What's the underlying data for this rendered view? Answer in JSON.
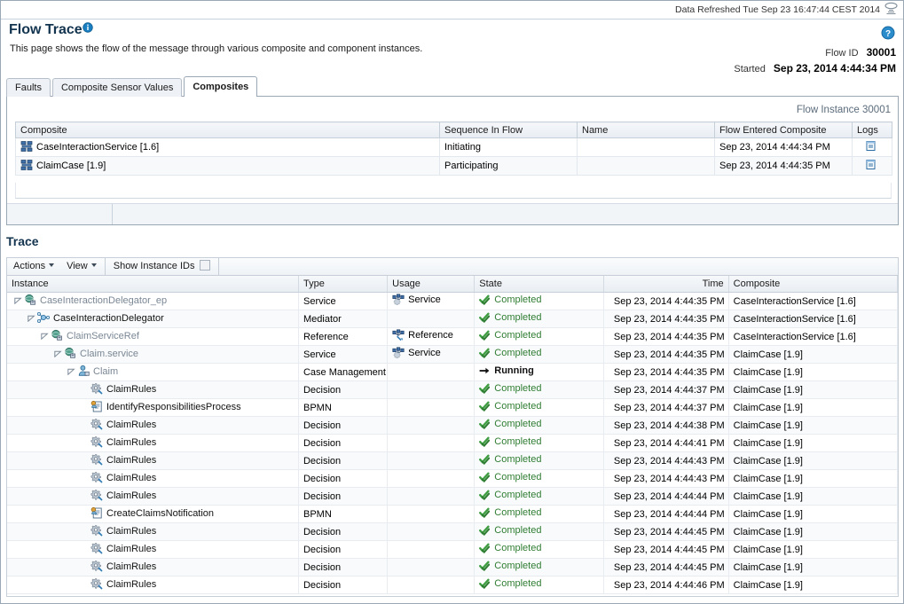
{
  "refresh": {
    "text": "Data Refreshed Tue Sep 23 16:47:44 CEST 2014",
    "icon": "refresh-monitor-icon"
  },
  "header": {
    "title": "Flow Trace",
    "title_info_icon": "info-icon",
    "subtitle": "This page shows the flow of the message through various composite and component instances.",
    "help_icon": "help-icon",
    "flow_id_label": "Flow ID",
    "flow_id_value": "30001",
    "started_label": "Started",
    "started_value": "Sep 23, 2014 4:44:34 PM"
  },
  "tabs": [
    {
      "label": "Faults",
      "active": false
    },
    {
      "label": "Composite Sensor Values",
      "active": false
    },
    {
      "label": "Composites",
      "active": true
    }
  ],
  "composites_panel": {
    "flow_instance_label": "Flow Instance 30001",
    "columns": [
      "Composite",
      "Sequence In Flow",
      "Name",
      "Flow Entered Composite",
      "Logs"
    ],
    "rows": [
      {
        "composite": "CaseInteractionService [1.6]",
        "icon": "composite-icon",
        "sequence": "Initiating",
        "name": "",
        "entered": "Sep 23, 2014 4:44:34 PM",
        "logs_icon": "logs-icon"
      },
      {
        "composite": "ClaimCase [1.9]",
        "icon": "composite-icon",
        "sequence": "Participating",
        "name": "",
        "entered": "Sep 23, 2014 4:44:35 PM",
        "logs_icon": "logs-icon"
      }
    ]
  },
  "trace": {
    "title": "Trace",
    "toolbar": {
      "actions_label": "Actions",
      "view_label": "View",
      "show_instance_ids_label": "Show Instance IDs",
      "show_instance_ids_checked": false
    },
    "columns": [
      "Instance",
      "Type",
      "Usage",
      "State",
      "Time",
      "Composite"
    ],
    "rows": [
      {
        "indent": 0,
        "twisty": "expanded",
        "icon": "service-icon",
        "instance": "CaseInteractionDelegator_ep",
        "muted": true,
        "type": "Service",
        "usage": "Service",
        "usage_icon": "service-usage-icon",
        "state": "Completed",
        "state_kind": "completed",
        "time": "Sep 23, 2014 4:44:35 PM",
        "composite": "CaseInteractionService [1.6]"
      },
      {
        "indent": 1,
        "twisty": "expanded",
        "icon": "mediator-icon",
        "instance": "CaseInteractionDelegator",
        "muted": false,
        "type": "Mediator",
        "usage": "",
        "usage_icon": "",
        "state": "Completed",
        "state_kind": "completed",
        "time": "Sep 23, 2014 4:44:35 PM",
        "composite": "CaseInteractionService [1.6]"
      },
      {
        "indent": 2,
        "twisty": "expanded",
        "icon": "service-icon",
        "instance": "ClaimServiceRef",
        "muted": true,
        "type": "Reference",
        "usage": "Reference",
        "usage_icon": "reference-usage-icon",
        "state": "Completed",
        "state_kind": "completed",
        "time": "Sep 23, 2014 4:44:35 PM",
        "composite": "CaseInteractionService [1.6]"
      },
      {
        "indent": 3,
        "twisty": "expanded",
        "icon": "service-icon",
        "instance": "Claim.service",
        "muted": true,
        "type": "Service",
        "usage": "Service",
        "usage_icon": "service-usage-icon",
        "state": "Completed",
        "state_kind": "completed",
        "time": "Sep 23, 2014 4:44:35 PM",
        "composite": "ClaimCase [1.9]"
      },
      {
        "indent": 4,
        "twisty": "expanded",
        "icon": "case-management-icon",
        "instance": "Claim",
        "muted": true,
        "type": "Case Management",
        "usage": "",
        "usage_icon": "",
        "state": "Running",
        "state_kind": "running",
        "time": "Sep 23, 2014 4:44:35 PM",
        "composite": "ClaimCase [1.9]"
      },
      {
        "indent": 5,
        "twisty": "none",
        "icon": "decision-icon",
        "instance": "ClaimRules",
        "muted": false,
        "type": "Decision",
        "usage": "",
        "usage_icon": "",
        "state": "Completed",
        "state_kind": "completed",
        "time": "Sep 23, 2014 4:44:37 PM",
        "composite": "ClaimCase [1.9]"
      },
      {
        "indent": 5,
        "twisty": "none",
        "icon": "bpmn-icon",
        "instance": "IdentifyResponsibilitiesProcess",
        "muted": false,
        "type": "BPMN",
        "usage": "",
        "usage_icon": "",
        "state": "Completed",
        "state_kind": "completed",
        "time": "Sep 23, 2014 4:44:37 PM",
        "composite": "ClaimCase [1.9]"
      },
      {
        "indent": 5,
        "twisty": "none",
        "icon": "decision-icon",
        "instance": "ClaimRules",
        "muted": false,
        "type": "Decision",
        "usage": "",
        "usage_icon": "",
        "state": "Completed",
        "state_kind": "completed",
        "time": "Sep 23, 2014 4:44:38 PM",
        "composite": "ClaimCase [1.9]"
      },
      {
        "indent": 5,
        "twisty": "none",
        "icon": "decision-icon",
        "instance": "ClaimRules",
        "muted": false,
        "type": "Decision",
        "usage": "",
        "usage_icon": "",
        "state": "Completed",
        "state_kind": "completed",
        "time": "Sep 23, 2014 4:44:41 PM",
        "composite": "ClaimCase [1.9]"
      },
      {
        "indent": 5,
        "twisty": "none",
        "icon": "decision-icon",
        "instance": "ClaimRules",
        "muted": false,
        "type": "Decision",
        "usage": "",
        "usage_icon": "",
        "state": "Completed",
        "state_kind": "completed",
        "time": "Sep 23, 2014 4:44:43 PM",
        "composite": "ClaimCase [1.9]"
      },
      {
        "indent": 5,
        "twisty": "none",
        "icon": "decision-icon",
        "instance": "ClaimRules",
        "muted": false,
        "type": "Decision",
        "usage": "",
        "usage_icon": "",
        "state": "Completed",
        "state_kind": "completed",
        "time": "Sep 23, 2014 4:44:43 PM",
        "composite": "ClaimCase [1.9]"
      },
      {
        "indent": 5,
        "twisty": "none",
        "icon": "decision-icon",
        "instance": "ClaimRules",
        "muted": false,
        "type": "Decision",
        "usage": "",
        "usage_icon": "",
        "state": "Completed",
        "state_kind": "completed",
        "time": "Sep 23, 2014 4:44:44 PM",
        "composite": "ClaimCase [1.9]"
      },
      {
        "indent": 5,
        "twisty": "none",
        "icon": "bpmn-icon",
        "instance": "CreateClaimsNotification",
        "muted": false,
        "type": "BPMN",
        "usage": "",
        "usage_icon": "",
        "state": "Completed",
        "state_kind": "completed",
        "time": "Sep 23, 2014 4:44:44 PM",
        "composite": "ClaimCase [1.9]"
      },
      {
        "indent": 5,
        "twisty": "none",
        "icon": "decision-icon",
        "instance": "ClaimRules",
        "muted": false,
        "type": "Decision",
        "usage": "",
        "usage_icon": "",
        "state": "Completed",
        "state_kind": "completed",
        "time": "Sep 23, 2014 4:44:45 PM",
        "composite": "ClaimCase [1.9]"
      },
      {
        "indent": 5,
        "twisty": "none",
        "icon": "decision-icon",
        "instance": "ClaimRules",
        "muted": false,
        "type": "Decision",
        "usage": "",
        "usage_icon": "",
        "state": "Completed",
        "state_kind": "completed",
        "time": "Sep 23, 2014 4:44:45 PM",
        "composite": "ClaimCase [1.9]"
      },
      {
        "indent": 5,
        "twisty": "none",
        "icon": "decision-icon",
        "instance": "ClaimRules",
        "muted": false,
        "type": "Decision",
        "usage": "",
        "usage_icon": "",
        "state": "Completed",
        "state_kind": "completed",
        "time": "Sep 23, 2014 4:44:45 PM",
        "composite": "ClaimCase [1.9]"
      },
      {
        "indent": 5,
        "twisty": "none",
        "icon": "decision-icon",
        "instance": "ClaimRules",
        "muted": false,
        "type": "Decision",
        "usage": "",
        "usage_icon": "",
        "state": "Completed",
        "state_kind": "completed",
        "time": "Sep 23, 2014 4:44:46 PM",
        "composite": "ClaimCase [1.9]"
      }
    ]
  },
  "colors": {
    "title": "#13344f",
    "completed": "#2f7d32",
    "muted_link": "#7a8794",
    "panel_border": "#9aa7b5"
  }
}
